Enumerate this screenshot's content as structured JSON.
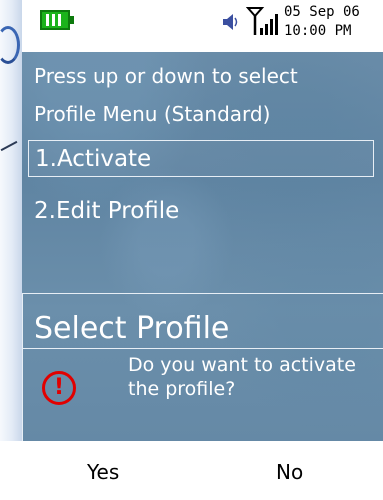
{
  "status": {
    "date": "05 Sep 06",
    "time": "10:00 PM",
    "icons": [
      "battery-icon",
      "speaker-icon",
      "signal-icon"
    ]
  },
  "instruction": {
    "line1": "Press up or down to select",
    "line2": "Profile Menu (Standard)"
  },
  "menu": {
    "items": [
      {
        "label": "1.Activate",
        "selected": true
      },
      {
        "label": "2.Edit Profile",
        "selected": false
      }
    ]
  },
  "dialog": {
    "title": "Select Profile",
    "message": "Do you want to activate the profile?",
    "icon": "alert-icon",
    "icon_color": "#e10000"
  },
  "softkeys": {
    "left": "Yes",
    "right": "No"
  }
}
